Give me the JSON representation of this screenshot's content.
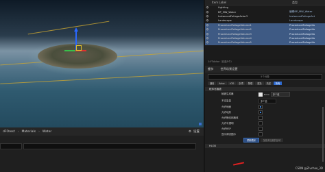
{
  "breadcrumbs": [
    "dFOrest",
    "Materials",
    "Water"
  ],
  "bottom_bar": {
    "settings_label": "设置"
  },
  "outliner": {
    "header_label": "Item Label",
    "header_type": "类型",
    "rows": [
      {
        "name": "Lighting",
        "type": "",
        "selected": false
      },
      {
        "name": "BP_MW_Water",
        "type": "编辑BP_MW_Water",
        "selected": false
      },
      {
        "name": "InstancedFoliageActor3",
        "type": "InstancedFoliageAct",
        "selected": false
      },
      {
        "name": "Landscape",
        "type": "Landscape",
        "selected": false
      },
      {
        "name": "ProceduralFoliageVolume1",
        "type": "ProceduralFoliageVo",
        "selected": true
      },
      {
        "name": "ProceduralFoliageVolume2",
        "type": "ProceduralFoliageVo",
        "selected": true
      },
      {
        "name": "ProceduralFoliageVolume3",
        "type": "ProceduralFoliageVo",
        "selected": true
      },
      {
        "name": "ProceduralFoliageVolume4",
        "type": "ProceduralFoliageVo",
        "selected": true
      },
      {
        "name": "ProceduralFoliageVolume5",
        "type": "ProceduralFoliageVo",
        "selected": true
      }
    ],
    "status": "14个Actor（已选5个）"
  },
  "details": {
    "tab_details": "细节",
    "tab_world": "世界场景设置",
    "search_placeholder": "5个对象",
    "filters": [
      "通用",
      "Actor",
      "LOD",
      "杂项",
      "物理",
      "渲染",
      "流送",
      "所有"
    ],
    "section_title": "程序化植被",
    "props": [
      {
        "label": "植被生成器",
        "kind": "spawner",
        "value": "多个值"
      },
      {
        "label": "",
        "kind": "buttons"
      },
      {
        "label": "",
        "kind": "blank"
      },
      {
        "label": "允许地面",
        "kind": "check",
        "checked": true
      },
      {
        "label": "允许地形",
        "kind": "check",
        "checked": true
      },
      {
        "label": "允许静态网格体",
        "kind": "check",
        "checked": false
      },
      {
        "label": "允许半透明",
        "kind": "check",
        "checked": false
      },
      {
        "label": "允许BSP",
        "kind": "check",
        "checked": false
      },
      {
        "label": "显示调试图示",
        "kind": "check",
        "checked": false
      }
    ],
    "spawner_value": "多个值",
    "spawner_thumb_label": "None",
    "relative_label": "不定量量",
    "relative_value": "多个值",
    "resimulate_label": "重新模拟",
    "load_unloaded_label": "加载未加载的区域",
    "bottom_section": "HLOD"
  },
  "watermark": "CSDN @Zivchao_3D"
}
